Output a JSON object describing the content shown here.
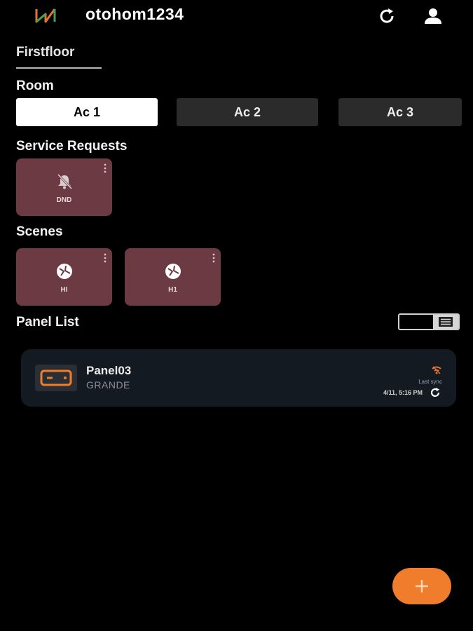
{
  "header": {
    "title": "otohom1234",
    "logo_icon": "otohom-logo-icon",
    "refresh_icon": "refresh-icon",
    "user_icon": "user-icon"
  },
  "floor": {
    "tab_label": "Firstfloor"
  },
  "rooms": {
    "label": "Room",
    "items": [
      {
        "label": "Ac 1",
        "active": true
      },
      {
        "label": "Ac 2",
        "active": false
      },
      {
        "label": "Ac 3",
        "active": false
      }
    ]
  },
  "service_requests": {
    "label": "Service Requests",
    "items": [
      {
        "label": "DND",
        "icon": "bell-off-icon"
      }
    ]
  },
  "scenes": {
    "label": "Scenes",
    "items": [
      {
        "label": "HI",
        "icon": "scene-icon"
      },
      {
        "label": "H1",
        "icon": "scene-icon"
      }
    ]
  },
  "panel_list": {
    "label": "Panel List",
    "view_toggle_icon": "list-view-icon",
    "panels": [
      {
        "name": "Panel03",
        "subtitle": "GRANDE",
        "last_sync_label": "Last sync",
        "last_sync_time": "4/11, 5:16 PM",
        "status_icon": "wifi-icon"
      }
    ]
  },
  "fab": {
    "icon": "plus-icon"
  },
  "colors": {
    "background": "#000000",
    "tile": "#6b3a43",
    "accent": "#f07d2c",
    "card": "#141a22",
    "room_inactive": "#2b2b2b",
    "room_active": "#ffffff"
  }
}
